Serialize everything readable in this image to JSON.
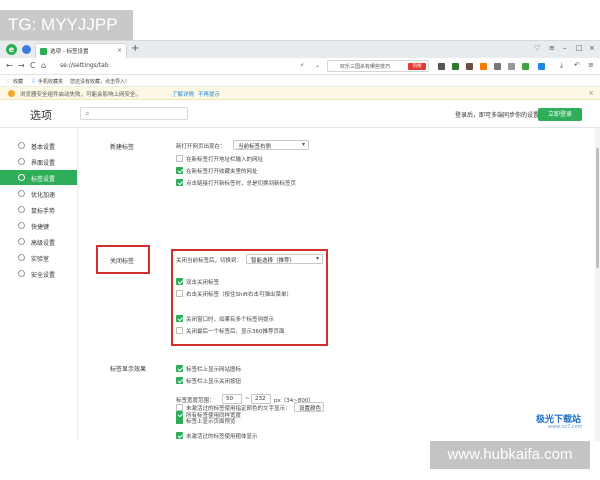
{
  "watermark_top": "TG: MYYJJPP",
  "watermark_bottom": "www.hubkaifa.com",
  "watermark_logo": "极光下载站",
  "watermark_logo_sub": "www.xz7.com",
  "tab": {
    "title": "选项 - 标签设置",
    "close": "×",
    "new": "+"
  },
  "window_controls": {
    "pin": "♡",
    "menu": "≡",
    "min": "–",
    "max": "□",
    "close": "×"
  },
  "address": {
    "url": "se://settings/tab",
    "back": "←",
    "forward": "→",
    "reload": "C",
    "home": "⌂",
    "star": "☆"
  },
  "search": {
    "text": "欢乐三国杀有哪些技巧",
    "badge": "热搜"
  },
  "bookmarks": {
    "fav": "收藏",
    "mobile": "手机收藏夹",
    "hint": "您还没有收藏，点击导入!"
  },
  "warning": {
    "text": "浏览器安全组件启动失败，可能会影响上网安全。",
    "link1": "了解详情",
    "link2": "不再提示",
    "close": "×"
  },
  "settings": {
    "title": "选项",
    "search_icon": "⌕",
    "login_text": "登录后，即可多端同步你的设置",
    "login_btn": "立即登录"
  },
  "sidebar": {
    "items": [
      {
        "label": "基本设置"
      },
      {
        "label": "界面设置"
      },
      {
        "label": "标签设置"
      },
      {
        "label": "优化加速"
      },
      {
        "label": "鼠标手势"
      },
      {
        "label": "快捷键"
      },
      {
        "label": "高级设置"
      },
      {
        "label": "实验室"
      },
      {
        "label": "安全设置"
      }
    ]
  },
  "new_tab": {
    "label": "新建标签",
    "open_mode_label": "新打开网页出现在：",
    "open_mode_value": "当前标签右侧",
    "opt1": "在新标签打开地址栏输入的网址",
    "opt2": "在新标签打开收藏夹里的网址",
    "opt3": "点击链接打开新标签时，总是切换到新标签页"
  },
  "close_tab": {
    "label": "关闭标签",
    "after_close_label": "关闭当前标签后，切换到：",
    "after_close_value": "智能选择（推荐）",
    "opt1": "双击关闭标签",
    "opt2": "右击关闭标签（按住Shift右击可弹出菜单）",
    "opt3": "关闭窗口时，如果有多个标签则提示",
    "opt4": "关闭最后一个标签后，显示360推荐页面"
  },
  "tab_display": {
    "label": "标签显示效果",
    "opt1": "标签栏上显示网站图标",
    "opt2": "标签栏上显示关闭按钮",
    "width_label": "标签宽度范围：",
    "width_min": "50",
    "width_sep": "~",
    "width_max": "232",
    "width_unit": "px（34~800）",
    "opt3": "所有标签使用同样宽度",
    "opt4": "未激活过的标签使用粗体显示",
    "opt5": "未激活过的标签使用指定颜色的文字显示：",
    "set_color": "设置颜色",
    "opt6": "标签上显示页面预览"
  }
}
